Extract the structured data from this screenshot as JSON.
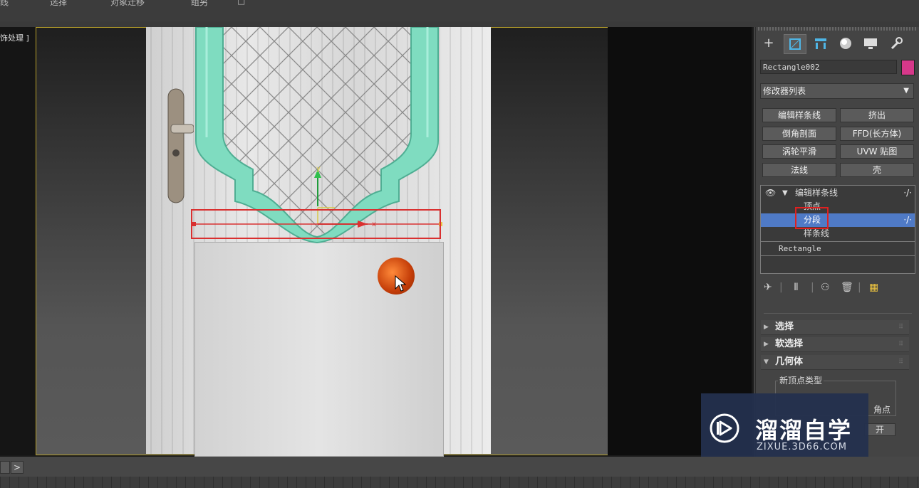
{
  "menubar": {
    "items": [
      "线",
      "选择",
      "对象迁移",
      "组另",
      "□"
    ]
  },
  "viewport": {
    "label": "[ 边缘面处理 ]",
    "label_visible": "饰处理 ]",
    "gizmo_y": "y",
    "gizmo_x": "x"
  },
  "command_panel": {
    "tabs": [
      "create-icon",
      "modify-icon",
      "hierarchy-icon",
      "motion-icon",
      "display-icon",
      "utilities-icon"
    ],
    "object_name": "Rectangle002",
    "object_color": "#d7388a",
    "modifier_list_label": "修改器列表",
    "modifier_buttons": [
      "编辑样条线",
      "挤出",
      "倒角剖面",
      "FFD(长方体)",
      "涡轮平滑",
      "UVW 贴图",
      "法线",
      "壳"
    ],
    "stack": {
      "modifier": "编辑样条线",
      "sub_items": [
        "顶点",
        "分段",
        "样条线"
      ],
      "selected": "分段",
      "base": "Rectangle"
    },
    "rollouts": [
      "选择",
      "软选择",
      "几何体"
    ],
    "geometry": {
      "group_title": "新顶点类型",
      "corner_label": "角点",
      "open_label": "开"
    }
  },
  "watermark": {
    "title": "溜溜自学",
    "subtitle": "ZIXUE.3D66.COM"
  },
  "bottom": {
    "next_arrow": ">"
  }
}
